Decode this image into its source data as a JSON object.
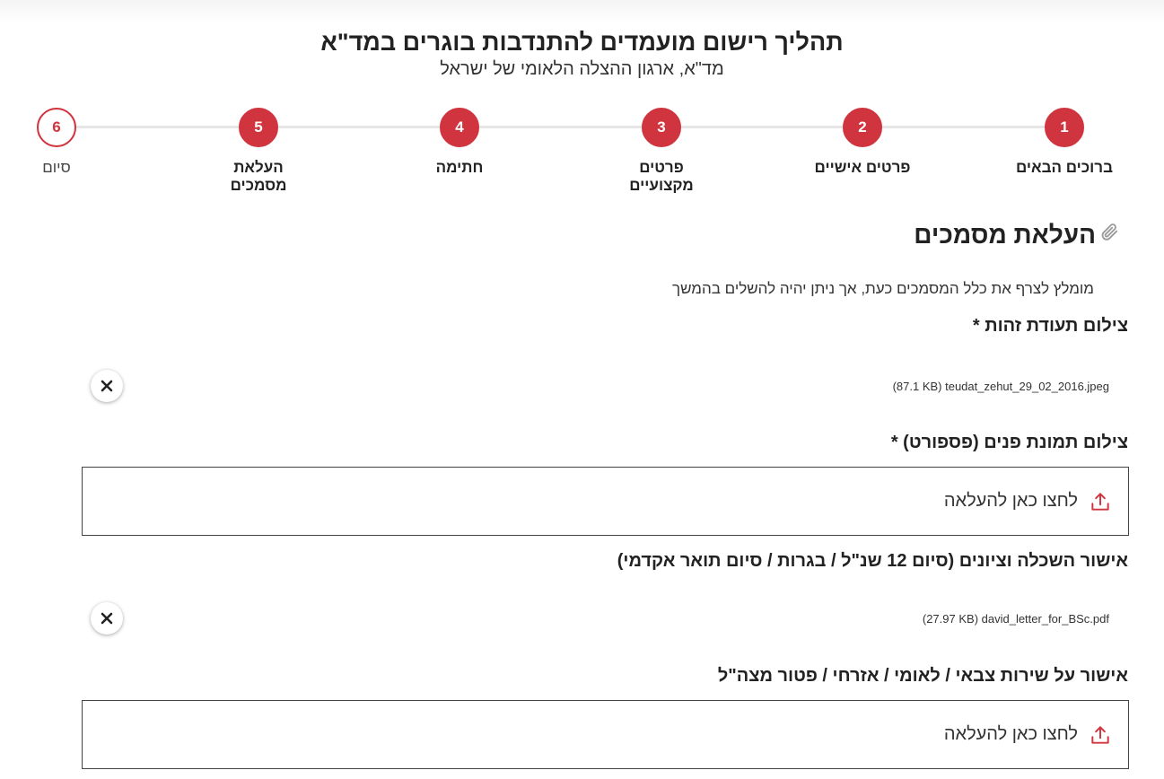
{
  "header": {
    "title": "תהליך רישום מועמדים להתנדבות בוגרים במד\"א",
    "subtitle": "מד\"א, ארגון ההצלה הלאומי של ישראל"
  },
  "steps": [
    {
      "number": "1",
      "label": "ברוכים הבאים"
    },
    {
      "number": "2",
      "label": "פרטים אישיים"
    },
    {
      "number": "3",
      "label": "פרטים מקצועיים"
    },
    {
      "number": "4",
      "label": "חתימה"
    },
    {
      "number": "5",
      "label": "העלאת מסמכים"
    },
    {
      "number": "6",
      "label": "סיום"
    }
  ],
  "section": {
    "title": "העלאת מסמכים",
    "intro": "מומלץ לצרף את כלל המסמכים כעת, אך ניתן יהיה להשלים בהמשך"
  },
  "fields": {
    "id_photo": {
      "label": "צילום תעודת זהות *",
      "file": "(87.1 KB) teudat_zehut_29_02_2016.jpeg"
    },
    "passport_photo": {
      "label": "צילום תמונת פנים (פספורט) *",
      "upload_text": "לחצו כאן להעלאה"
    },
    "education": {
      "label": "אישור השכלה וציונים (סיום 12 שנ\"ל / בגרות / סיום תואר אקדמי)",
      "file": "(27.97 KB) david_letter_for_BSc.pdf"
    },
    "service": {
      "label": "אישור על שירות צבאי / לאומי / אזרחי / פטור מצה\"ל",
      "upload_text": "לחצו כאן להעלאה"
    }
  },
  "colors": {
    "accent": "#d0343f",
    "track": "#e6e6e6"
  }
}
